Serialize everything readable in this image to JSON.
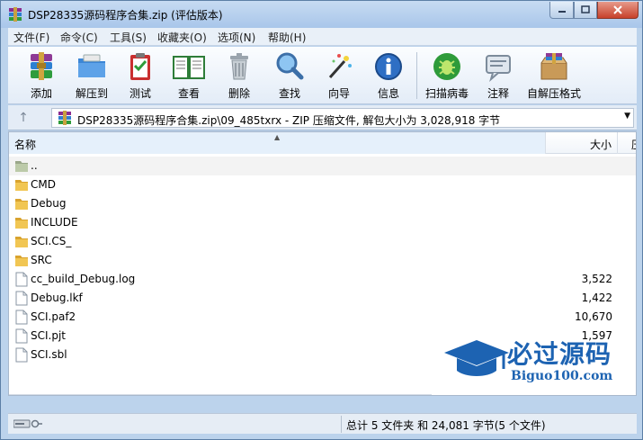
{
  "window": {
    "title": "DSP28335源码程序合集.zip (评估版本)"
  },
  "menu": [
    "文件(F)",
    "命令(C)",
    "工具(S)",
    "收藏夹(O)",
    "选项(N)",
    "帮助(H)"
  ],
  "toolbar": {
    "buttons": [
      {
        "label": "添加",
        "icon": "add-archive-icon"
      },
      {
        "label": "解压到",
        "icon": "extract-folder-icon"
      },
      {
        "label": "测试",
        "icon": "test-clipboard-icon"
      },
      {
        "label": "查看",
        "icon": "view-book-icon"
      },
      {
        "label": "删除",
        "icon": "trash-icon"
      },
      {
        "label": "查找",
        "icon": "magnifier-icon"
      },
      {
        "label": "向导",
        "icon": "wizard-wand-icon"
      },
      {
        "label": "信息",
        "icon": "info-icon"
      },
      {
        "label": "扫描病毒",
        "icon": "virus-scan-icon"
      },
      {
        "label": "注释",
        "icon": "comment-icon"
      },
      {
        "label": "自解压格式",
        "icon": "sfx-box-icon"
      }
    ]
  },
  "address": {
    "text": "DSP28335源码程序合集.zip\\09_485txrx - ZIP 压缩文件, 解包大小为 3,028,918 字节"
  },
  "columns": {
    "name": "名称",
    "size": "大小",
    "packed": "压"
  },
  "files": [
    {
      "name": "..",
      "size": "",
      "type": "parent"
    },
    {
      "name": "CMD",
      "size": "",
      "type": "folder"
    },
    {
      "name": "Debug",
      "size": "",
      "type": "folder"
    },
    {
      "name": "INCLUDE",
      "size": "",
      "type": "folder"
    },
    {
      "name": "SCI.CS_",
      "size": "",
      "type": "folder"
    },
    {
      "name": "SRC",
      "size": "",
      "type": "folder"
    },
    {
      "name": "cc_build_Debug.log",
      "size": "3,522",
      "type": "file"
    },
    {
      "name": "Debug.lkf",
      "size": "1,422",
      "type": "file"
    },
    {
      "name": "SCI.paf2",
      "size": "10,670",
      "type": "file"
    },
    {
      "name": "SCI.pjt",
      "size": "1,597",
      "type": "file"
    },
    {
      "name": "SCI.sbl",
      "size": "",
      "type": "file"
    }
  ],
  "watermark": {
    "title": "必过源码",
    "subtitle": "Biguo100.com"
  },
  "status": {
    "text": "总计 5 文件夹 和 24,081 字节(5 个文件)"
  },
  "colors": {
    "title_bg": "#b9d1ee",
    "accent": "#1d63b2",
    "folder": "#e8b53a"
  }
}
